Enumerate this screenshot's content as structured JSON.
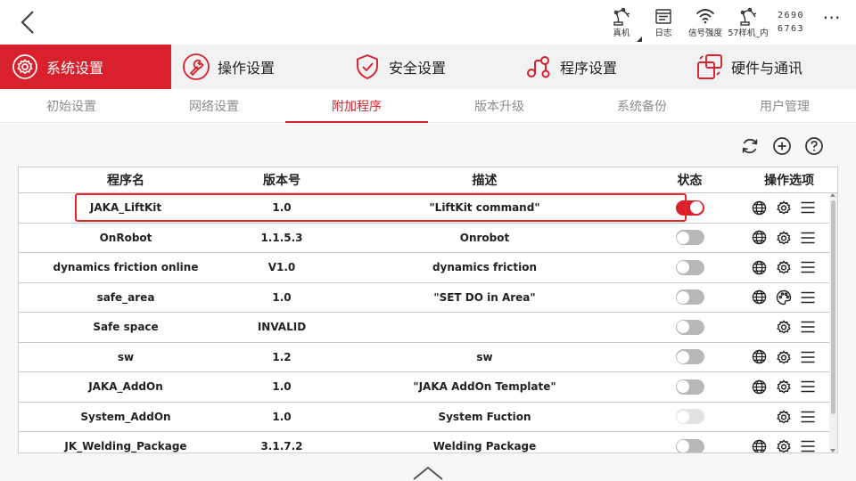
{
  "status_bar": {
    "items": [
      {
        "label": "真机",
        "icon": "robot-arm-icon"
      },
      {
        "label": "日志",
        "icon": "log-icon"
      },
      {
        "label": "信号强度",
        "icon": "wifi-icon"
      },
      {
        "label": "57样机_内",
        "icon": "robot-arm-icon"
      }
    ],
    "serial_top": "2690",
    "serial_bottom": "6763",
    "more": "⋯"
  },
  "main_tabs": [
    {
      "label": "系统设置",
      "icon": "system-settings-icon",
      "active": true
    },
    {
      "label": "操作设置",
      "icon": "wrench-icon",
      "active": false
    },
    {
      "label": "安全设置",
      "icon": "shield-icon",
      "active": false
    },
    {
      "label": "程序设置",
      "icon": "program-icon",
      "active": false
    },
    {
      "label": "硬件与通讯",
      "icon": "hardware-icon",
      "active": false
    }
  ],
  "sub_tabs": [
    {
      "label": "初始设置",
      "active": false
    },
    {
      "label": "网络设置",
      "active": false
    },
    {
      "label": "附加程序",
      "active": true
    },
    {
      "label": "版本升级",
      "active": false
    },
    {
      "label": "系统备份",
      "active": false
    },
    {
      "label": "用户管理",
      "active": false
    }
  ],
  "toolbar_icons": [
    "refresh-icon",
    "add-icon",
    "help-icon"
  ],
  "table": {
    "headers": [
      "程序名",
      "版本号",
      "描述",
      "状态",
      "操作选项"
    ],
    "rows": [
      {
        "name": "JAKA_LiftKit",
        "version": "1.0",
        "description": "\"LiftKit command\"",
        "enabled": true,
        "disabled_toggle": false,
        "web": true,
        "settings": "gear"
      },
      {
        "name": "OnRobot",
        "version": "1.1.5.3",
        "description": "Onrobot",
        "enabled": false,
        "disabled_toggle": false,
        "web": true,
        "settings": "gear"
      },
      {
        "name": "dynamics friction online",
        "version": "V1.0",
        "description": "dynamics friction",
        "enabled": false,
        "disabled_toggle": false,
        "web": true,
        "settings": "gear"
      },
      {
        "name": "safe_area",
        "version": "1.0",
        "description": "\"SET DO in Area\"",
        "enabled": false,
        "disabled_toggle": false,
        "web": true,
        "settings": "palette"
      },
      {
        "name": "Safe space",
        "version": "INVALID",
        "description": "",
        "enabled": false,
        "disabled_toggle": false,
        "web": false,
        "settings": "gear"
      },
      {
        "name": "sw",
        "version": "1.2",
        "description": "sw",
        "enabled": false,
        "disabled_toggle": false,
        "web": true,
        "settings": "gear"
      },
      {
        "name": "JAKA_AddOn",
        "version": "1.0",
        "description": "\"JAKA AddOn Template\"",
        "enabled": false,
        "disabled_toggle": false,
        "web": true,
        "settings": "gear"
      },
      {
        "name": "System_AddOn",
        "version": "1.0",
        "description": "System Fuction",
        "enabled": false,
        "disabled_toggle": true,
        "web": false,
        "settings": "gear"
      },
      {
        "name": "JK_Welding_Package",
        "version": "3.1.7.2",
        "description": "Welding Package",
        "enabled": false,
        "disabled_toggle": false,
        "web": true,
        "settings": "gear"
      }
    ]
  },
  "colors": {
    "accent": "#d8212c",
    "highlight_border": "#e8252b",
    "toggle_off": "#b7b7b7",
    "toggle_disabled": "#e2e2e2",
    "tab_bar_bg": "#f2f2f2",
    "subtab_inactive": "#8c8c8c"
  }
}
